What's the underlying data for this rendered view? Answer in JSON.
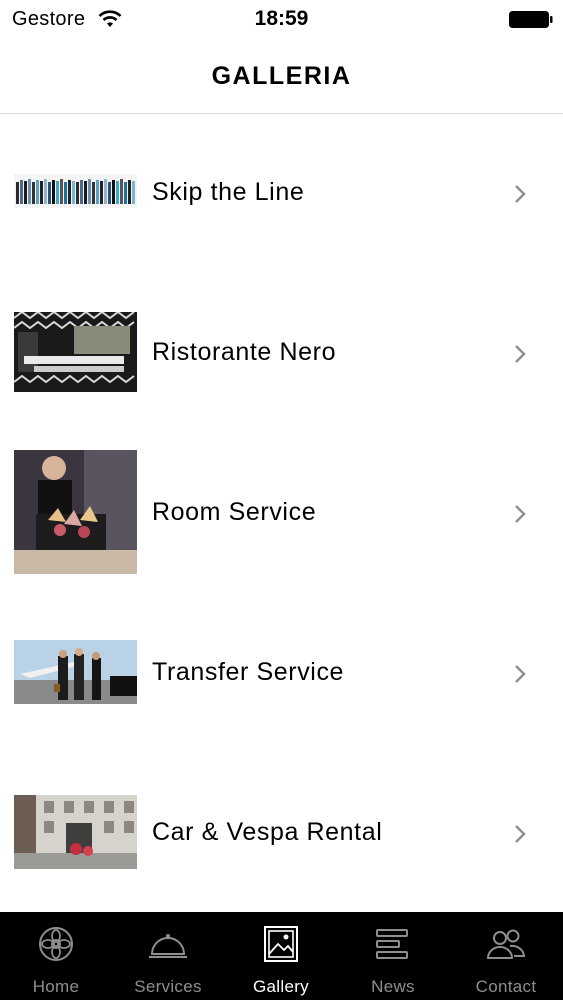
{
  "status_bar": {
    "carrier": "Gestore",
    "time": "18:59"
  },
  "nav": {
    "title": "GALLERIA"
  },
  "gallery": {
    "items": [
      {
        "label": "Skip the Line",
        "thumb_icon": "crowd-line-photo"
      },
      {
        "label": "Ristorante Nero",
        "thumb_icon": "restaurant-photo"
      },
      {
        "label": "Room Service",
        "thumb_icon": "waiter-photo"
      },
      {
        "label": "Transfer Service",
        "thumb_icon": "jet-limo-photo"
      },
      {
        "label": "Car & Vespa Rental",
        "thumb_icon": "hotel-facade-photo"
      }
    ]
  },
  "tabs": [
    {
      "label": "Home",
      "icon": "flower-icon",
      "active": false
    },
    {
      "label": "Services",
      "icon": "cloche-icon",
      "active": false
    },
    {
      "label": "Gallery",
      "icon": "picture-icon",
      "active": true
    },
    {
      "label": "News",
      "icon": "lines-icon",
      "active": false
    },
    {
      "label": "Contact",
      "icon": "people-icon",
      "active": false
    }
  ],
  "colors": {
    "tab_bar_bg": "#000000",
    "tab_inactive": "#8e8e8e",
    "tab_active": "#ffffff",
    "chevron": "#8e8e93"
  }
}
